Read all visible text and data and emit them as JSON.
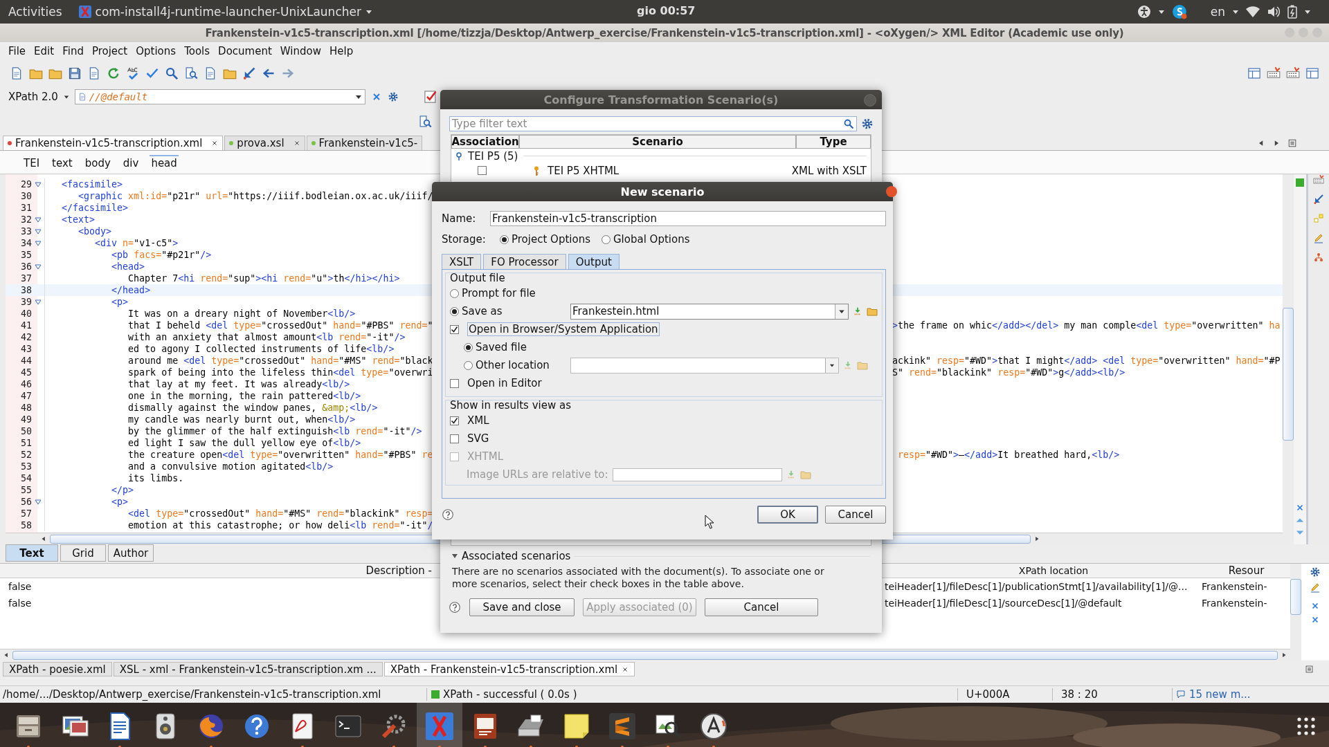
{
  "top_bar": {
    "activities": "Activities",
    "app_menu": "com-install4j-runtime-launcher-UnixLauncher",
    "clock": "gio 00:57",
    "language": "en"
  },
  "window": {
    "title": "Frankenstein-v1c5-transcription.xml [/home/tizzja/Desktop/Antwerp_exercise/Frankenstein-v1c5-transcription.xml] - <oXygen/> XML Editor (Academic use only)"
  },
  "menu": [
    "File",
    "Edit",
    "Find",
    "Project",
    "Options",
    "Tools",
    "Document",
    "Window",
    "Help"
  ],
  "xpath_bar": {
    "version": "XPath 2.0",
    "query": "//@default"
  },
  "editor_tabs": [
    {
      "label": "Frankenstein-v1c5-transcription.xml",
      "selected": true,
      "color": "#e0443a",
      "closable": true
    },
    {
      "label": "prova.xsl",
      "selected": false,
      "color": "#7cc242",
      "closable": true
    },
    {
      "label": "Frankenstein-v1c5-",
      "selected": false,
      "color": "#7cc242",
      "closable": false
    }
  ],
  "breadcrumb": [
    {
      "label": "TEI",
      "selected": false
    },
    {
      "label": "text",
      "selected": false
    },
    {
      "label": "body",
      "selected": false
    },
    {
      "label": "div",
      "selected": false
    },
    {
      "label": "head",
      "selected": true
    }
  ],
  "code_lines": [
    {
      "number": "29",
      "foldable": true,
      "current": false,
      "text": "   <facsimile>"
    },
    {
      "number": "30",
      "foldable": false,
      "current": false,
      "text": "      <graphic xml:id=\"p21r\" url=\"https://iiif.bodleian.ox.ac.uk/iiif/"
    },
    {
      "number": "31",
      "foldable": false,
      "current": false,
      "text": "   </facsimile>"
    },
    {
      "number": "32",
      "foldable": true,
      "current": false,
      "text": "   <text>"
    },
    {
      "number": "33",
      "foldable": true,
      "current": false,
      "text": "      <body>"
    },
    {
      "number": "34",
      "foldable": true,
      "current": false,
      "text": "         <div n=\"v1-c5\">"
    },
    {
      "number": "35",
      "foldable": false,
      "current": false,
      "text": "            <pb facs=\"#p21r\"/>"
    },
    {
      "number": "36",
      "foldable": true,
      "current": false,
      "text": "            <head>"
    },
    {
      "number": "37",
      "foldable": false,
      "current": false,
      "text": "               Chapter 7<hi rend=\"sup\"><hi rend=\"u\">th</hi></hi>"
    },
    {
      "number": "38",
      "foldable": false,
      "current": true,
      "text": "            </head>"
    },
    {
      "number": "39",
      "foldable": true,
      "current": false,
      "text": "            <p>"
    },
    {
      "number": "40",
      "foldable": false,
      "current": false,
      "text": "               It was on a dreary night of November<lb/>"
    },
    {
      "number": "41",
      "foldable": false,
      "current": false,
      "text": "               that I beheld <del type=\"crossedOut\" hand=\"#PBS\" rend=\"",
      "right": ">the frame on whic</add></del> my man comple<del type=\"overwritten\" ha",
      "right_continues_value": false
    },
    {
      "number": "42",
      "foldable": false,
      "current": false,
      "text": "               with an anxiety that almost amount<lb rend=\"-it\"/>"
    },
    {
      "number": "43",
      "foldable": false,
      "current": false,
      "text": "               ed to agony I collected instruments of life<lb/>"
    },
    {
      "number": "44",
      "foldable": false,
      "current": false,
      "text": "               around me <del type=\"crossedOut\" hand=\"#MS\" rend=\"black",
      "right": "ackink\" resp=\"#WD\">that I might</add> <del type=\"overwritten\" hand=\"#P",
      "right_continues_value": true
    },
    {
      "number": "45",
      "foldable": false,
      "current": false,
      "text": "               spark of being into the lifeless thin<del type=\"overwri",
      "right": "S\" rend=\"blackink\" resp=\"#WD\">g</add><lb/>",
      "right_continues_value": true
    },
    {
      "number": "46",
      "foldable": false,
      "current": false,
      "text": "               that lay at my feet. It was already<lb/>"
    },
    {
      "number": "47",
      "foldable": false,
      "current": false,
      "text": "               one in the morning, the rain pattered<lb/>"
    },
    {
      "number": "48",
      "foldable": false,
      "current": false,
      "text": "               dismally against the window panes, &amp;<lb/>"
    },
    {
      "number": "49",
      "foldable": false,
      "current": false,
      "text": "               my candle was nearly burnt out, when<lb/>"
    },
    {
      "number": "50",
      "foldable": false,
      "current": false,
      "text": "               by the glimmer of the half extinguish<lb rend=\"-it\"/>"
    },
    {
      "number": "51",
      "foldable": false,
      "current": false,
      "text": "               ed light I saw the dull yellow eye of<lb/>"
    },
    {
      "number": "52",
      "foldable": false,
      "current": false,
      "text": "               the creature open<del type=\"overwritten\" hand=\"#PBS\" re",
      "right": " resp=\"#WD\">—</add>It breathed hard,<lb/>",
      "right_continues_value": false
    },
    {
      "number": "53",
      "foldable": false,
      "current": false,
      "text": "               and a convulsive motion agitated<lb/>"
    },
    {
      "number": "54",
      "foldable": false,
      "current": false,
      "text": "               its limbs."
    },
    {
      "number": "55",
      "foldable": false,
      "current": false,
      "text": "            </p>"
    },
    {
      "number": "56",
      "foldable": true,
      "current": false,
      "text": "            <p>"
    },
    {
      "number": "57",
      "foldable": false,
      "current": false,
      "text": "               <del type=\"crossedOut\" hand=\"#MS\" rend=\"blackink\" resp="
    },
    {
      "number": "58",
      "foldable": false,
      "current": false,
      "text": "               emotion at this catastrophe; or how deli<lb rend=\"-it\"/"
    }
  ],
  "view_modes": [
    {
      "label": "Text",
      "selected": true
    },
    {
      "label": "Grid",
      "selected": false
    },
    {
      "label": "Author",
      "selected": false
    }
  ],
  "results": {
    "columns": [
      "Description -",
      "XPath location",
      "Resour"
    ],
    "rows": [
      {
        "description": "false",
        "xpath": "teiHeader[1]/fileDesc[1]/publicationStmt[1]/availability[1]/@...",
        "resource": "Frankenstein-"
      },
      {
        "description": "false",
        "xpath": "teiHeader[1]/fileDesc[1]/sourceDesc[1]/@default",
        "resource": "Frankenstein-"
      }
    ]
  },
  "result_tabs": [
    {
      "label": "XPath - poesie.xml",
      "selected": false,
      "closable": false
    },
    {
      "label": "XSL - xml - Frankenstein-v1c5-transcription.xm ...",
      "selected": false,
      "closable": false
    },
    {
      "label": "XPath - Frankenstein-v1c5-transcription.xml",
      "selected": true,
      "closable": true
    }
  ],
  "status_bar": {
    "path": "/home/.../Desktop/Antwerp_exercise/Frankenstein-v1c5-transcription.xml",
    "message": "XPath - successful  ( 0.0s )",
    "character": "U+000A",
    "position": "38 : 20",
    "notifications": "15 new m..."
  },
  "dock": [
    {
      "kind": "files",
      "running": true
    },
    {
      "kind": "photos",
      "running": false
    },
    {
      "kind": "writer",
      "running": true
    },
    {
      "kind": "speaker",
      "running": false
    },
    {
      "kind": "browser",
      "running": true
    },
    {
      "kind": "help",
      "running": false
    },
    {
      "kind": "pdf",
      "running": true
    },
    {
      "kind": "terminal",
      "running": false
    },
    {
      "kind": "tools",
      "running": true
    },
    {
      "kind": "xeditor",
      "running": true
    },
    {
      "kind": "impress",
      "running": true
    },
    {
      "kind": "scanner",
      "running": true
    },
    {
      "kind": "notes",
      "running": true
    },
    {
      "kind": "stripes",
      "running": true
    },
    {
      "kind": "magnifier",
      "running": true
    },
    {
      "kind": "updater",
      "running": true
    }
  ],
  "configure_dialog": {
    "title": "Configure Transformation Scenario(s)",
    "filter_placeholder": "Type filter text",
    "columns": [
      "Association",
      "Scenario",
      "Type"
    ],
    "group": {
      "label": "TEI P5 (5)",
      "expanded": true
    },
    "scenario": {
      "name": "TEI P5 XHTML",
      "type": "XML with XSLT",
      "checked": false
    },
    "associated_title": "Associated scenarios",
    "associated_message": "There are no scenarios associated with the document(s). To associate one or more scenarios, select their check boxes in the table above.",
    "buttons": [
      {
        "label": "Save and close",
        "disabled": false
      },
      {
        "label": "Apply associated (0)",
        "disabled": true
      },
      {
        "label": "Cancel",
        "disabled": false
      }
    ]
  },
  "new_scenario": {
    "title": "New scenario",
    "name_label": "Name:",
    "name_value": "Frankenstein-v1c5-transcription",
    "storage_label": "Storage:",
    "storage": [
      {
        "label": "Project Options",
        "selected": true
      },
      {
        "label": "Global Options",
        "selected": false
      }
    ],
    "tabs": [
      {
        "label": "XSLT",
        "selected": false
      },
      {
        "label": "FO Processor",
        "selected": false
      },
      {
        "label": "Output",
        "selected": true
      }
    ],
    "output_title": "Output file",
    "output_options": [
      {
        "label": "Prompt for file",
        "selected": false
      },
      {
        "label": "Save as",
        "selected": true
      }
    ],
    "save_as_value": "Frankestein.html",
    "open_in_browser": {
      "label": "Open in Browser/System Application",
      "checked": true
    },
    "browser_options": [
      {
        "label": "Saved file",
        "selected": true
      },
      {
        "label": "Other location",
        "selected": false
      }
    ],
    "open_in_editor": {
      "label": "Open in Editor",
      "checked": false
    },
    "results_title": "Show in results view as",
    "results_options": [
      {
        "label": "XML",
        "checked": true,
        "disabled": false
      },
      {
        "label": "SVG",
        "checked": false,
        "disabled": false
      },
      {
        "label": "XHTML",
        "checked": false,
        "disabled": true
      }
    ],
    "image_urls_label": "Image URLs are relative to:",
    "buttons": [
      {
        "label": "OK",
        "default": true
      },
      {
        "label": "Cancel",
        "default": false
      }
    ]
  }
}
